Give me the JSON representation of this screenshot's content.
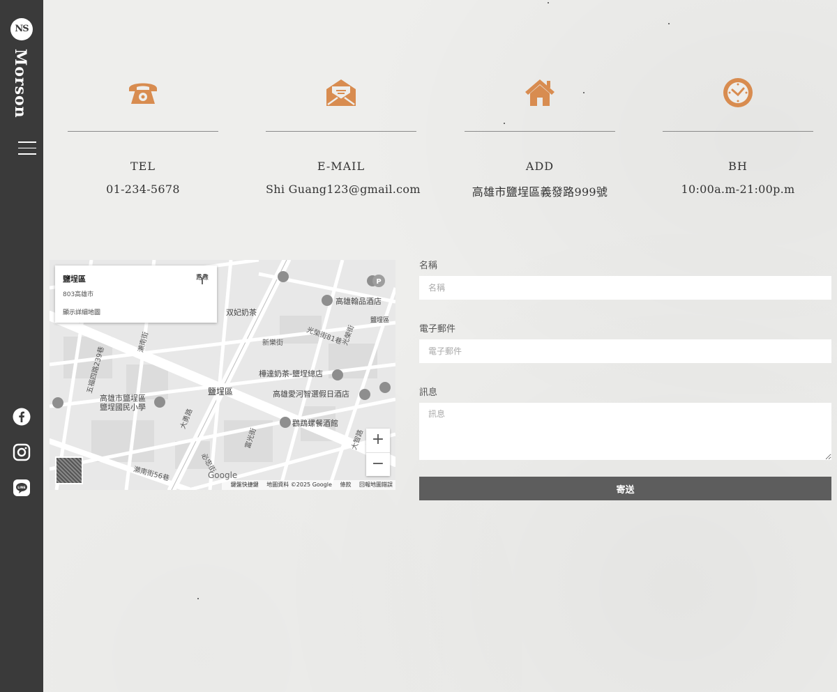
{
  "sidebar": {
    "logo_text": "NS",
    "brand": "Morson",
    "social": [
      "facebook-icon",
      "instagram-icon",
      "line-icon"
    ]
  },
  "colors": {
    "accent": "#d88c50",
    "sidebar": "#3a3a3a",
    "button": "#5d5d5d"
  },
  "contact": [
    {
      "icon": "phone-icon",
      "label": "TEL",
      "value": "01-234-5678"
    },
    {
      "icon": "envelope-icon",
      "label": "E-MAIL",
      "value": "Shi Guang123@gmail.com"
    },
    {
      "icon": "house-icon",
      "label": "ADD",
      "value": "高雄市鹽埕區義發路999號"
    },
    {
      "icon": "clock-icon",
      "label": "BH",
      "value": "10:00a.m-21:00p.m"
    }
  ],
  "map": {
    "card_title": "鹽埕區",
    "card_subtitle": "803高雄市",
    "card_link": "顯示詳細地圖",
    "directions": "路線",
    "labels": {
      "district": "鹽埕區",
      "hotel1": "高雄翰品酒店",
      "tea1": "双妃奶茶",
      "tea2": "樺達奶茶-鹽埕總店",
      "hotel2": "高雄愛河智選假日酒店",
      "restaurant": "鸛鵡螺餐酒館",
      "school1": "高雄市鹽埕區",
      "school2": "鹽埕國民小學",
      "street1": "新樂街",
      "street2": "光榮街81巷",
      "street3": "大勇路",
      "street4": "瀨南街56巷",
      "street5": "五福四路239巷",
      "street6": "必忠街",
      "street7": "大智路",
      "street8": "光榮街",
      "street9": "鹽埕區",
      "street10": "瀨南街",
      "street11": "富光街"
    },
    "zoom_in": "+",
    "zoom_out": "−",
    "google": "Google",
    "attribution": [
      "鍵盤快捷鍵",
      "地圖資料 ©2025 Google",
      "條款",
      "回報地圖錯誤"
    ]
  },
  "form": {
    "name_label": "名稱",
    "name_placeholder": "名稱",
    "email_label": "電子郵件",
    "email_placeholder": "電子郵件",
    "message_label": "訊息",
    "message_placeholder": "訊息",
    "submit": "寄送"
  }
}
